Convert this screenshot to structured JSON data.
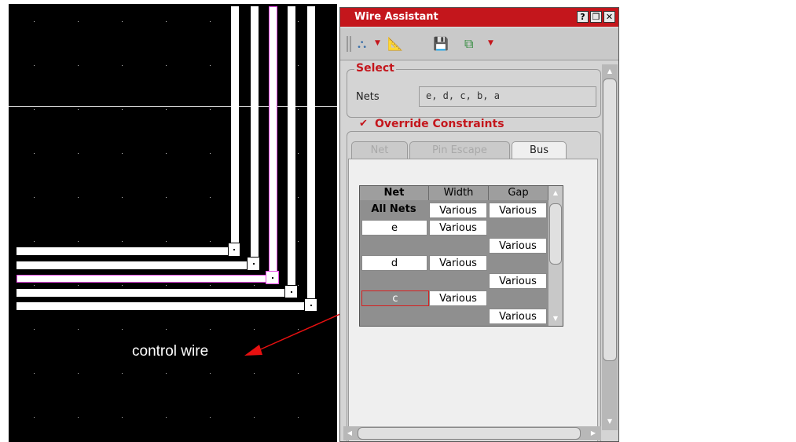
{
  "layout": {
    "annotation_label": "control wire",
    "wire_color": "#ffffff",
    "selected_wire_color": "#e64ae6",
    "arrow_color": "#e81010"
  },
  "panel": {
    "title": "Wire Assistant",
    "title_buttons": [
      "?",
      "❒",
      "✕"
    ],
    "toolbar_icons": [
      "hierarchy-icon",
      "ruler-icon",
      "save-icon",
      "net-icon"
    ],
    "select_group": {
      "label": "Select",
      "nets_label": "Nets",
      "nets_value": "e, d, c, b, a"
    },
    "override": {
      "checked": true,
      "checkmark": "✔",
      "label": "Override Constraints"
    },
    "tabs": [
      {
        "label": "Net",
        "active": false
      },
      {
        "label": "Pin Escape",
        "active": false
      },
      {
        "label": "Bus",
        "active": true
      }
    ],
    "table": {
      "headers": [
        "Net",
        "Width",
        "Gap"
      ],
      "rows": [
        {
          "net": "All Nets",
          "width": "Various",
          "gap": "Various"
        },
        {
          "net": "e",
          "width": "Various",
          "gap": ""
        },
        {
          "net": "",
          "width": "",
          "gap": "Various"
        },
        {
          "net": "d",
          "width": "Various",
          "gap": ""
        },
        {
          "net": "",
          "width": "",
          "gap": "Various"
        },
        {
          "net": "c",
          "width": "Various",
          "gap": ""
        },
        {
          "net": "",
          "width": "",
          "gap": "Various"
        }
      ]
    },
    "accent_color": "#c4161c"
  }
}
